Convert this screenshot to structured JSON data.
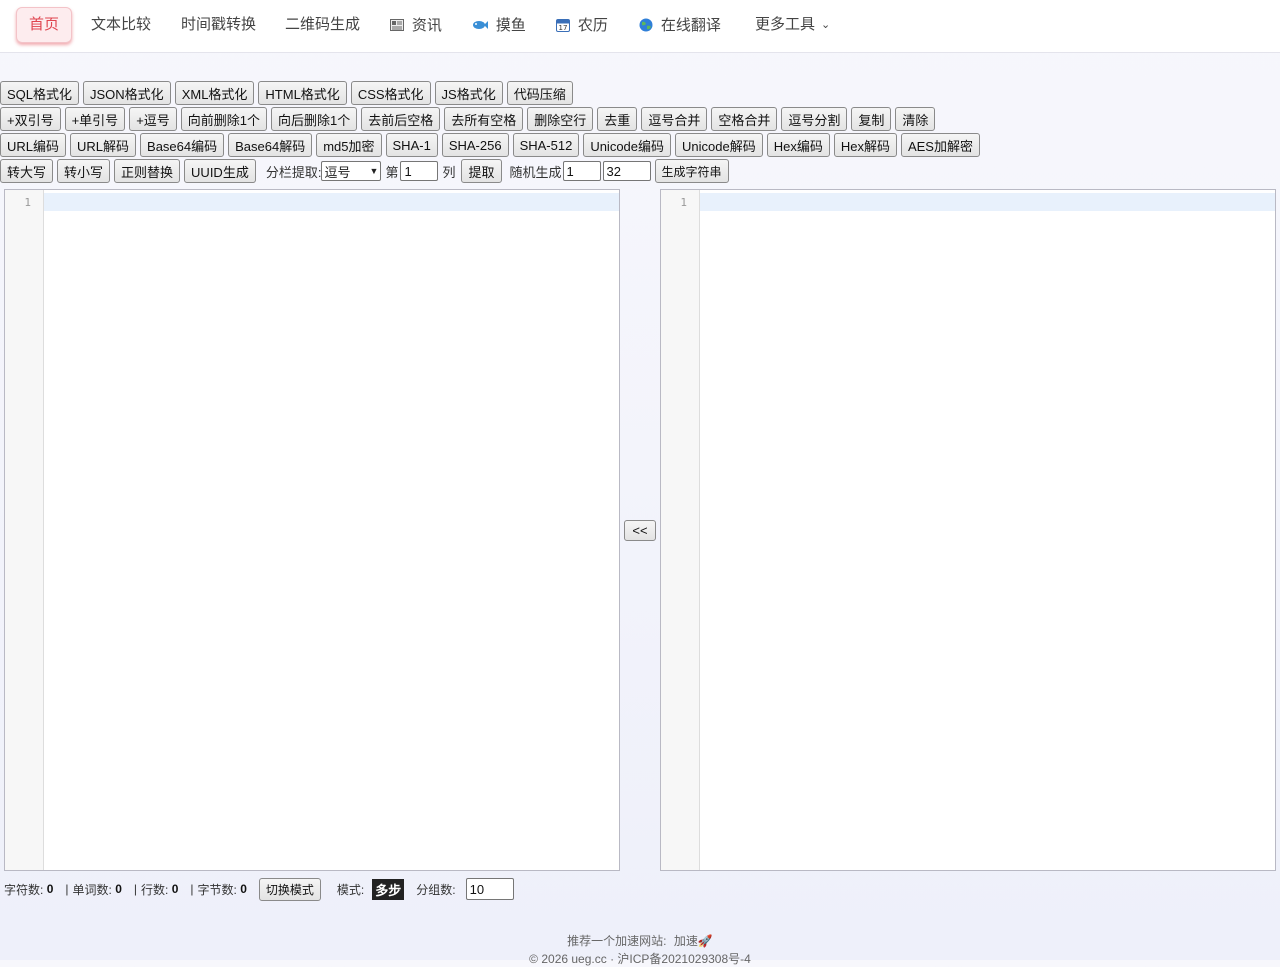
{
  "nav": {
    "home": "首页",
    "text_compare": "文本比较",
    "timestamp": "时间戳转换",
    "qrcode": "二维码生成",
    "news": "资讯",
    "slack": "摸鱼",
    "calendar": "农历",
    "translate": "在线翻译",
    "more": "更多工具"
  },
  "icons": {
    "news": "newspaper-icon",
    "slack": "fish-icon",
    "calendar": "calendar-icon",
    "translate": "globe-icon"
  },
  "toolbar": {
    "row1": [
      "SQL格式化",
      "JSON格式化",
      "XML格式化",
      "HTML格式化",
      "CSS格式化",
      "JS格式化",
      "代码压缩"
    ],
    "row2": [
      "+双引号",
      "+单引号",
      "+逗号",
      "向前删除1个",
      "向后删除1个",
      "去前后空格",
      "去所有空格",
      "删除空行",
      "去重",
      "逗号合并",
      "空格合并",
      "逗号分割",
      "复制",
      "清除"
    ],
    "row3": [
      "URL编码",
      "URL解码",
      "Base64编码",
      "Base64解码",
      "md5加密",
      "SHA-1",
      "SHA-256",
      "SHA-512",
      "Unicode编码",
      "Unicode解码",
      "Hex编码",
      "Hex解码",
      "AES加解密"
    ],
    "row4": {
      "upper": "转大写",
      "lower": "转小写",
      "regex": "正则替换",
      "uuid": "UUID生成",
      "split_label": "分栏提取:",
      "split_select": "逗号",
      "col_prefix": "第",
      "col_value": "1",
      "col_suffix": "列",
      "extract": "提取",
      "random_label": "随机生成",
      "random_count": "1",
      "random_length": "32",
      "gen_string": "生成字符串"
    }
  },
  "editors": {
    "left_line": "1",
    "right_line": "1",
    "copy_back": "<<"
  },
  "status": {
    "chars_label": "字符数:",
    "chars": "0",
    "words_label": "单词数:",
    "words": "0",
    "lines_label": "行数:",
    "lines": "0",
    "bytes_label": "字节数:",
    "bytes": "0",
    "switch_mode": "切换模式",
    "mode_label": "模式:",
    "mode": "多步",
    "groups_label": "分组数:",
    "groups": "10"
  },
  "footer": {
    "recommend": "推荐一个加速网站:",
    "recommend_link": "加速🚀",
    "copyright": "© 2026 ueg.cc · 沪ICP备2021029308号-4"
  }
}
